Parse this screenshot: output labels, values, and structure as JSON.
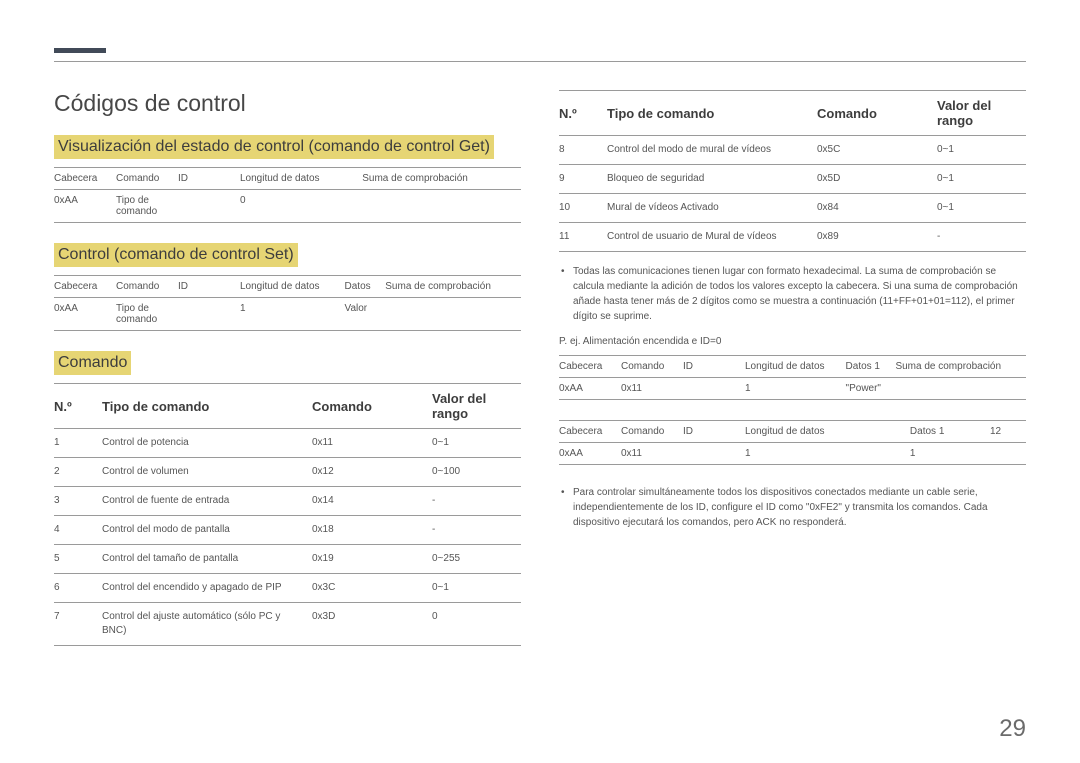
{
  "title": "Códigos de control",
  "section1": {
    "heading": "Visualización del estado de control (comando de control Get)",
    "headers": [
      "Cabecera",
      "Comando",
      "ID",
      "Longitud de datos",
      "Suma de comprobación"
    ],
    "row": [
      "0xAA",
      "Tipo de comando",
      "",
      "0",
      ""
    ]
  },
  "section2": {
    "heading": "Control (comando de control Set)",
    "headers": [
      "Cabecera",
      "Comando",
      "ID",
      "Longitud de datos",
      "Datos",
      "Suma de comprobación"
    ],
    "row": [
      "0xAA",
      "Tipo de comando",
      "",
      "1",
      "Valor",
      ""
    ]
  },
  "section3": {
    "heading": "Comando",
    "columns": [
      "N.º",
      "Tipo de comando",
      "Comando",
      "Valor del rango"
    ],
    "rows": [
      {
        "no": "1",
        "type": "Control de potencia",
        "cmd": "0x11",
        "range": "0~1"
      },
      {
        "no": "2",
        "type": "Control de volumen",
        "cmd": "0x12",
        "range": "0~100"
      },
      {
        "no": "3",
        "type": "Control de fuente de entrada",
        "cmd": "0x14",
        "range": "-"
      },
      {
        "no": "4",
        "type": "Control del modo de pantalla",
        "cmd": "0x18",
        "range": "-"
      },
      {
        "no": "5",
        "type": "Control del tamaño de pantalla",
        "cmd": "0x19",
        "range": "0~255"
      },
      {
        "no": "6",
        "type": "Control del encendido y apagado de PIP",
        "cmd": "0x3C",
        "range": "0~1"
      },
      {
        "no": "7",
        "type": "Control del ajuste automático (sólo PC y BNC)",
        "cmd": "0x3D",
        "range": "0"
      }
    ]
  },
  "section3b": {
    "columns": [
      "N.º",
      "Tipo de comando",
      "Comando",
      "Valor del rango"
    ],
    "rows": [
      {
        "no": "8",
        "type": "Control del modo de mural de vídeos",
        "cmd": "0x5C",
        "range": "0~1"
      },
      {
        "no": "9",
        "type": "Bloqueo de seguridad",
        "cmd": "0x5D",
        "range": "0~1"
      },
      {
        "no": "10",
        "type": "Mural de vídeos Activado",
        "cmd": "0x84",
        "range": "0~1"
      },
      {
        "no": "11",
        "type": "Control de usuario de Mural de vídeos",
        "cmd": "0x89",
        "range": "-"
      }
    ]
  },
  "bullet1": "Todas las comunicaciones tienen lugar con formato hexadecimal. La suma de comprobación se calcula mediante la adición de todos los valores excepto la cabecera. Si una suma de comprobación añade hasta tener más de 2 dígitos como se muestra a continuación (11+FF+01+01=112), el primer dígito se suprime.",
  "example_label": "P. ej. Alimentación encendida e ID=0",
  "example1": {
    "headers": [
      "Cabecera",
      "Comando",
      "ID",
      "Longitud de datos",
      "Datos 1",
      "Suma de comprobación"
    ],
    "row": [
      "0xAA",
      "0x11",
      "",
      "1",
      "\"Power\"",
      ""
    ]
  },
  "example2": {
    "headers": [
      "Cabecera",
      "Comando",
      "ID",
      "Longitud de datos",
      "Datos 1",
      "12"
    ],
    "row": [
      "0xAA",
      "0x11",
      "",
      "1",
      "1",
      ""
    ]
  },
  "bullet2": "Para controlar simultáneamente todos los dispositivos conectados mediante un cable serie, independientemente de los ID, configure el ID como \"0xFE2\" y transmita los comandos. Cada dispositivo ejecutará los comandos, pero ACK no responderá.",
  "page_number": "29"
}
